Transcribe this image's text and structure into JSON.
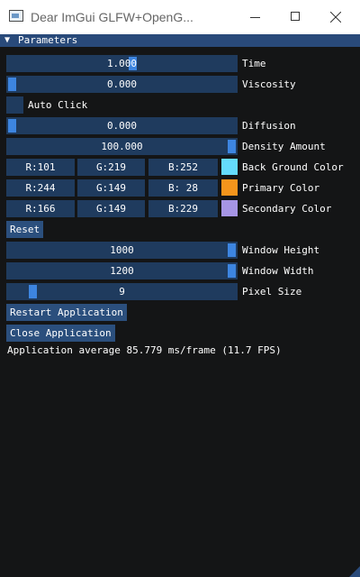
{
  "window": {
    "title": "Dear ImGui GLFW+OpenG...",
    "minimize_label": "Minimize",
    "maximize_label": "Maximize",
    "close_label": "Close"
  },
  "panel": {
    "title": "Parameters",
    "collapse_glyph": "▼"
  },
  "sliders": {
    "time": {
      "label": "Time",
      "value": "1.000",
      "level": 0.53
    },
    "viscosity": {
      "label": "Viscosity",
      "value": "0.000",
      "level": 0.0
    },
    "diffusion": {
      "label": "Diffusion",
      "value": "0.000",
      "level": 0.0
    },
    "density": {
      "label": "Density Amount",
      "value": "100.000",
      "level": 1.0
    },
    "window_height": {
      "label": "Window Height",
      "value": "1000",
      "level": 1.0
    },
    "window_width": {
      "label": "Window Width",
      "value": "1200",
      "level": 1.0
    },
    "pixel_size": {
      "label": "Pixel Size",
      "value": "9",
      "level": 0.1
    }
  },
  "checkbox": {
    "label": "Auto Click",
    "checked": false
  },
  "colors": {
    "background": {
      "label": "Back Ground Color",
      "r": "R:101",
      "g": "G:219",
      "b": "B:252",
      "hex": "#65dbfc"
    },
    "primary": {
      "label": "Primary Color",
      "r": "R:244",
      "g": "G:149",
      "b": "B: 28",
      "hex": "#f4951c"
    },
    "secondary": {
      "label": "Secondary Color",
      "r": "R:166",
      "g": "G:149",
      "b": "B:229",
      "hex": "#a695e5"
    }
  },
  "buttons": {
    "reset": "Reset",
    "restart": "Restart Application",
    "close": "Close Application"
  },
  "status": {
    "fps_text": "Application average 85.779 ms/frame (11.7 FPS)"
  },
  "theme": {
    "frame_bg": "#1f3b5e",
    "grab": "#3d85e0",
    "title_bg": "#294a7a",
    "window_bg": "#141516"
  }
}
